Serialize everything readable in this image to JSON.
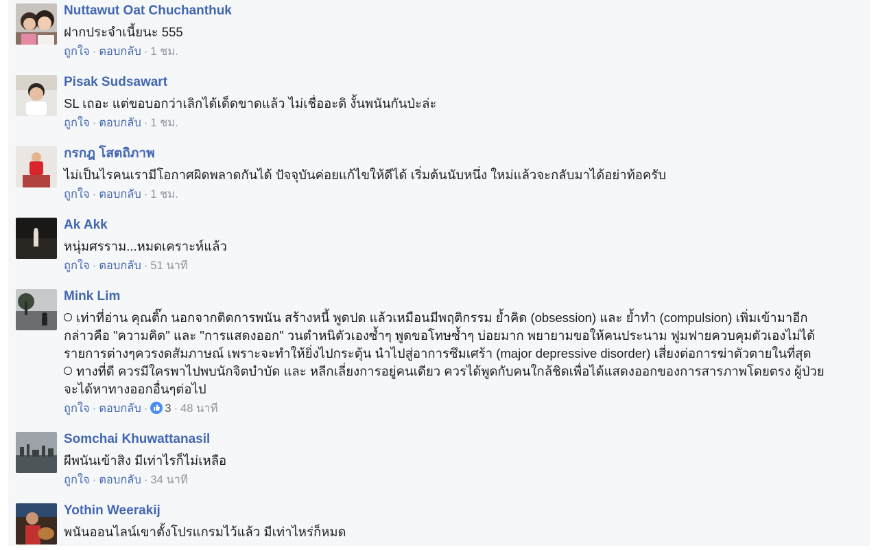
{
  "actions": {
    "like": "ถูกใจ",
    "reply": "ตอบกลับ",
    "dot": "·"
  },
  "comments": [
    {
      "name": "Nuttawut Oat Chuchanthuk",
      "text": "ฝากประจำเนี้ยนะ 555",
      "time": "1 ชม.",
      "avatar": "two-girls-photo"
    },
    {
      "name": "Pisak Sudsawart",
      "text": "SL เถอะ แต่ขอบอกว่าเลิกได้เด็ดขาดแล้ว ไม่เชื่ออะดิ งั้นพนันกันป่ะล่ะ",
      "time": "1 ชม.",
      "avatar": "child-photo"
    },
    {
      "name": "กรกฎ โสตถิภาพ",
      "text": "ไม่เป็นไรคนเรามีโอกาศผิดพลาดกันได้ ปัจจุบันค่อยแก้ไขให้ดีได้ เริ่มต้นนับหนึ่ง ใหม่แล้วจะกลับมาได้อย่าท้อครับ",
      "time": "1 ชม.",
      "avatar": "kid-red-shirt-photo"
    },
    {
      "name": "Ak Akk",
      "text": "หนุ่มศรราม...หมดเคราะห์แล้ว",
      "time": "51 นาที",
      "avatar": "dark-figure-photo"
    },
    {
      "name": "Mink Lim",
      "lines": [
        "เท่าที่อ่าน คุณติ๊ก นอกจากติดการพนัน สร้างหนี้ พูดปด แล้วเหมือนมีพฤติกรรม ย้ำคิด (obsession) และ ย้ำทำ (compulsion) เพิ่มเข้ามาอีก",
        "กล่าวคือ \"ความคิด\" และ \"การแสดงออก\" วนตำหนิตัวเองซ้ำๆ พูดขอโทษซ้ำๆ บ่อยมาก พยายามขอให้คนประนาม ฟูมฟายควบคุมตัวเองไม่ได้",
        "รายการต่างๆควรงดสัมภาษณ์ เพราะจะทำให้ยิ่งไปกระตุ้น นำไปสู่อาการซึมเศร้า (major depressive disorder) เสี่ยงต่อการฆ่าตัวตายในที่สุด",
        "ทางที่ดี ควรมีใครพาไปพบนักจิตบำบัด และ หลีกเลี่ยงการอยู่คนเดียว ควรได้พูดกับคนใกล้ชิดเพื่อได้แสดงออกของการสารภาพโดยตรง ผู้ป่วย",
        "จะได้หาทางออกอื่นๆต่อไป"
      ],
      "likes": "3",
      "time": "48 นาที",
      "avatar": "person-by-lake-photo"
    },
    {
      "name": "Somchai Khuwattanasil",
      "text": "ผีพนันเข้าสิง มีเท่าไรก็ไม่เหลือ",
      "time": "34 นาที",
      "avatar": "city-skyline-photo"
    },
    {
      "name": "Yothin Weerakij",
      "text": "พนันออนไลน์เขาตั้งโปรแกรมไว้แล้ว มีเท่าไหร่ก็หมด",
      "time": "",
      "avatar": "man-with-guitar-photo"
    }
  ],
  "colors": {
    "name": "#4267b2",
    "meta": "#90949c",
    "panel": "#f6f7f9",
    "like_badge": "#4a8cf7"
  }
}
